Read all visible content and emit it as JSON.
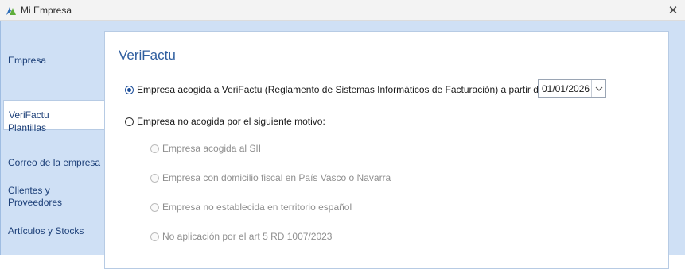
{
  "window": {
    "title": "Mi Empresa",
    "close_glyph": "✕"
  },
  "sidebar": {
    "items": [
      {
        "label": "Empresa",
        "active": false
      },
      {
        "label": "VeriFactu",
        "active": true
      },
      {
        "label": "Plantillas",
        "active": false
      },
      {
        "label": "Correo de la empresa",
        "active": false
      },
      {
        "label": "Clientes y Proveedores",
        "active": false
      },
      {
        "label": "Artículos y Stocks",
        "active": false
      }
    ]
  },
  "main": {
    "title": "VeriFactu",
    "option_acogida": {
      "label": "Empresa acogida a VeriFactu (Reglamento de Sistemas Informáticos de Facturación) a partir de",
      "checked": true,
      "date_value": "01/01/2026"
    },
    "option_no_acogida": {
      "label": "Empresa no acogida por el siguiente motivo:",
      "checked": false
    },
    "motivos": [
      {
        "label": "Empresa acogida al SII",
        "enabled": false
      },
      {
        "label": "Empresa con domicilio fiscal en País Vasco o Navarra",
        "enabled": false
      },
      {
        "label": "Empresa no establecida en territorio español",
        "enabled": false
      },
      {
        "label": "No aplicación por el art 5 RD 1007/2023",
        "enabled": false
      }
    ]
  },
  "colors": {
    "frame": "#cfe0f5",
    "accent": "#2f5e9f",
    "nav_text": "#1c3f78"
  }
}
